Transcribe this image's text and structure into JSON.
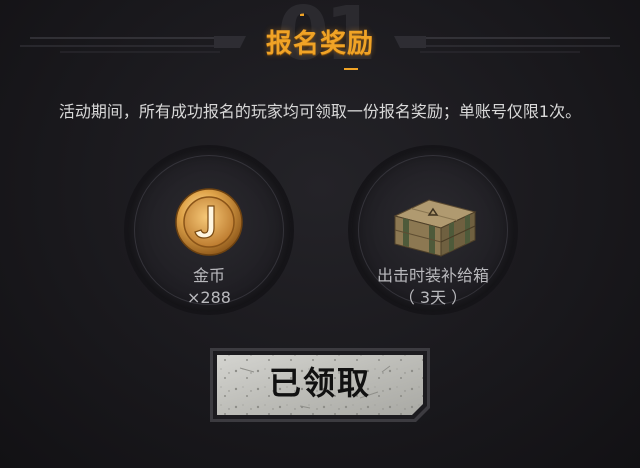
{
  "header": {
    "bg_number": "01",
    "title": "报名奖励"
  },
  "description": "活动期间，所有成功报名的玩家均可领取一份报名奖励；单账号仅限1次。",
  "rewards": [
    {
      "name": "金币",
      "quantity": "×288",
      "icon": "gold-coin-icon"
    },
    {
      "name": "出击时装补给箱",
      "quantity": "（ 3天 ）",
      "icon": "supply-crate-icon"
    }
  ],
  "claim_button": {
    "label": "已领取",
    "state": "claimed"
  },
  "colors": {
    "background": "#17161a",
    "title": "#f0a326",
    "text": "#d9d9d9",
    "muted_text": "#b9b9bd",
    "coin_gold": "#d99a3a",
    "button_face": "#c8c8c4"
  }
}
